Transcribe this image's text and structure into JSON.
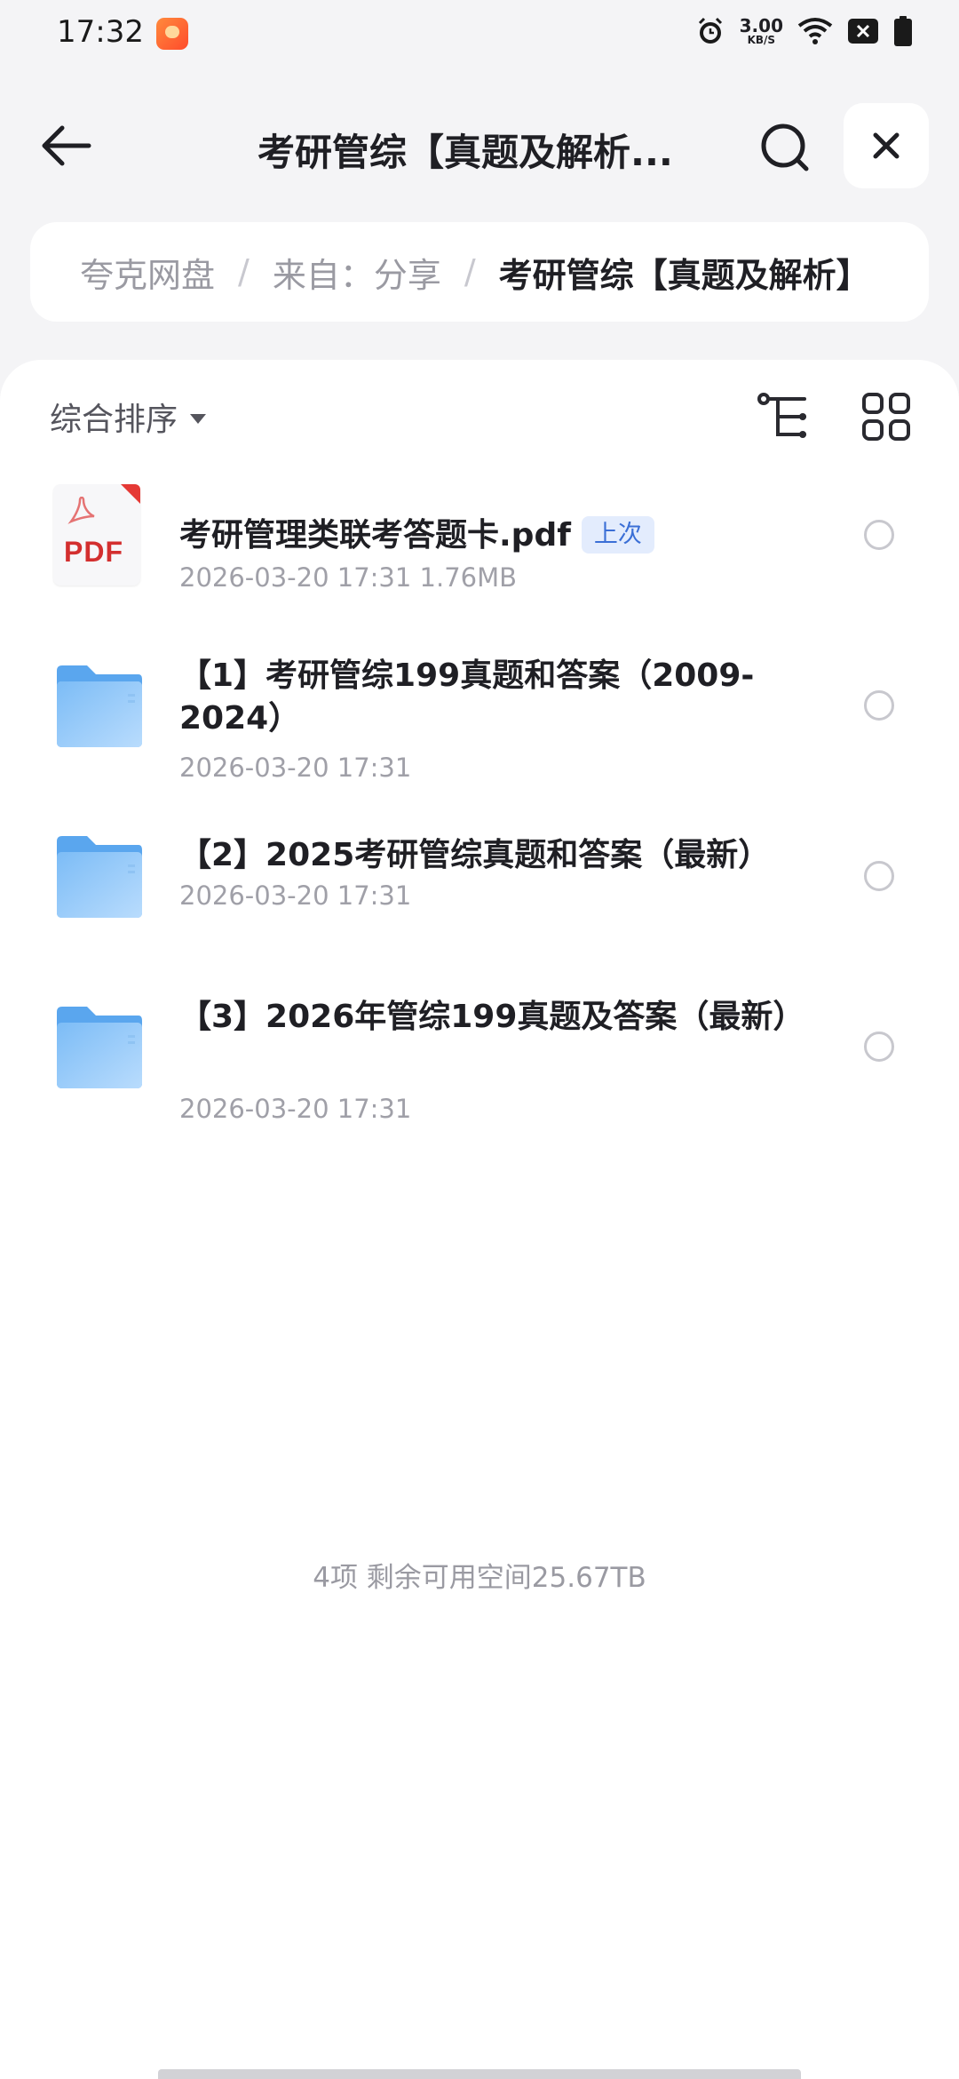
{
  "status_bar": {
    "time": "17:32",
    "app_notification_icon": "quark-app-icon",
    "alarm_icon": "alarm-icon",
    "net_speed_value": "3.00",
    "net_speed_unit": "KB/S",
    "wifi_icon": "wifi-icon",
    "sim_icon": "no-sim-icon",
    "battery_icon": "battery-icon"
  },
  "header": {
    "title": "考研管综【真题及解析...",
    "back_icon": "back-arrow-icon",
    "search_icon": "search-icon",
    "close_icon": "close-icon"
  },
  "breadcrumb": {
    "items": [
      "夸克网盘",
      "来自：分享",
      "考研管综【真题及解析】"
    ],
    "separator": "/"
  },
  "toolbar": {
    "sort_label": "综合排序",
    "tree_view_icon": "tree-view-icon",
    "grid_view_icon": "grid-view-icon"
  },
  "files": [
    {
      "type": "pdf",
      "name": "考研管理类联考答题卡.pdf",
      "tag": "上次",
      "meta": "2026-03-20 17:31  1.76MB",
      "thumb_label": "PDF"
    },
    {
      "type": "folder",
      "name": "【1】考研管综199真题和答案（2009-2024）",
      "meta": "2026-03-20 17:31"
    },
    {
      "type": "folder",
      "name": "【2】2025考研管综真题和答案（最新）",
      "meta": "2026-03-20 17:31"
    },
    {
      "type": "folder",
      "name": "【3】2026年管综199真题及答案（最新）",
      "meta": "2026-03-20 17:31"
    }
  ],
  "footer": {
    "summary": "4项 剩余可用空间25.67TB"
  },
  "colors": {
    "accent": "#3b6fd6",
    "folder": "#6fb3f5",
    "pdf_red": "#d32f2f"
  }
}
